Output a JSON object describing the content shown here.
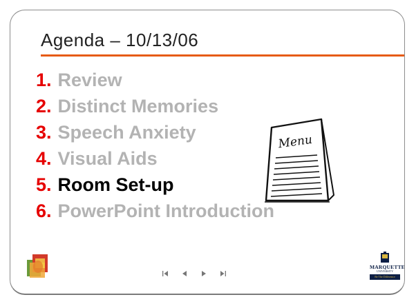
{
  "slide": {
    "title": "Agenda – 10/13/06",
    "accent_color": "#e65a0f",
    "number_color": "#e60000",
    "dim_text_color": "#b3b3b3",
    "active_text_color": "#000000",
    "agenda": [
      {
        "num": "1.",
        "text": "Review",
        "current": false
      },
      {
        "num": "2.",
        "text": "Distinct Memories",
        "current": false
      },
      {
        "num": "3.",
        "text": "Speech Anxiety",
        "current": false
      },
      {
        "num": "4.",
        "text": "Visual Aids",
        "current": false
      },
      {
        "num": "5.",
        "text": "Room Set-up",
        "current": true
      },
      {
        "num": "6.",
        "text": "PowerPoint Introduction",
        "current": false
      }
    ],
    "illustration": {
      "icon": "menu-card-icon",
      "text": "Menu"
    }
  },
  "navigation": {
    "buttons": [
      "first-slide-icon",
      "previous-slide-icon",
      "next-slide-icon",
      "last-slide-icon"
    ]
  },
  "logos": {
    "left": "colorful-squares-logo",
    "right": {
      "name": "MARQUETTE",
      "subtitle": "UNIVERSITY",
      "tagline": "Be The Difference"
    }
  }
}
